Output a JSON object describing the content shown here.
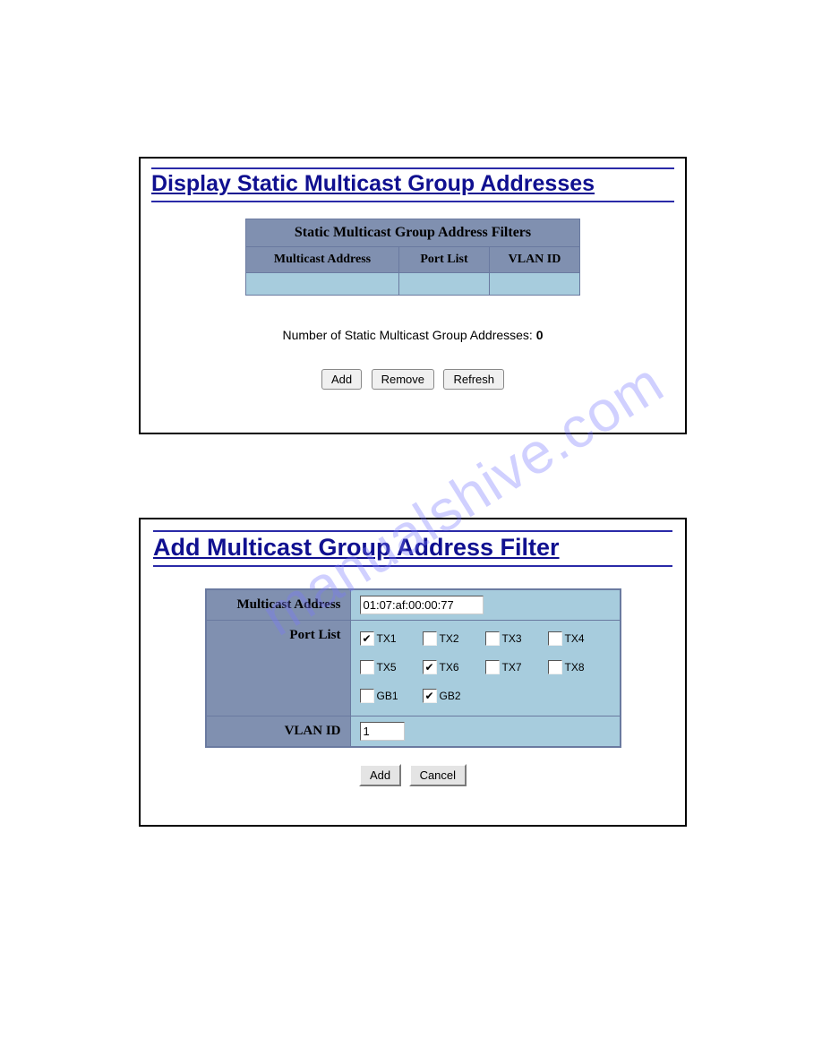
{
  "watermark": "manualshive.com",
  "panel1": {
    "title": "Display Static Multicast Group Addresses",
    "table_caption": "Static Multicast Group Address Filters",
    "columns": [
      "Multicast Address",
      "Port List",
      "VLAN ID"
    ],
    "count_label": "Number of Static Multicast Group Addresses: ",
    "count_value": "0",
    "buttons": {
      "add": "Add",
      "remove": "Remove",
      "refresh": "Refresh"
    }
  },
  "panel2": {
    "title": "Add Multicast Group Address Filter",
    "rows": {
      "multicast_label": "Multicast Address",
      "multicast_value": "01:07:af:00:00:77",
      "portlist_label": "Port List",
      "vlan_label": "VLAN ID",
      "vlan_value": "1"
    },
    "ports": [
      {
        "name": "TX1",
        "checked": true
      },
      {
        "name": "TX2",
        "checked": false
      },
      {
        "name": "TX3",
        "checked": false
      },
      {
        "name": "TX4",
        "checked": false
      },
      {
        "name": "TX5",
        "checked": false
      },
      {
        "name": "TX6",
        "checked": true
      },
      {
        "name": "TX7",
        "checked": false
      },
      {
        "name": "TX8",
        "checked": false
      },
      {
        "name": "GB1",
        "checked": false
      },
      {
        "name": "GB2",
        "checked": true
      }
    ],
    "buttons": {
      "add": "Add",
      "cancel": "Cancel"
    }
  }
}
